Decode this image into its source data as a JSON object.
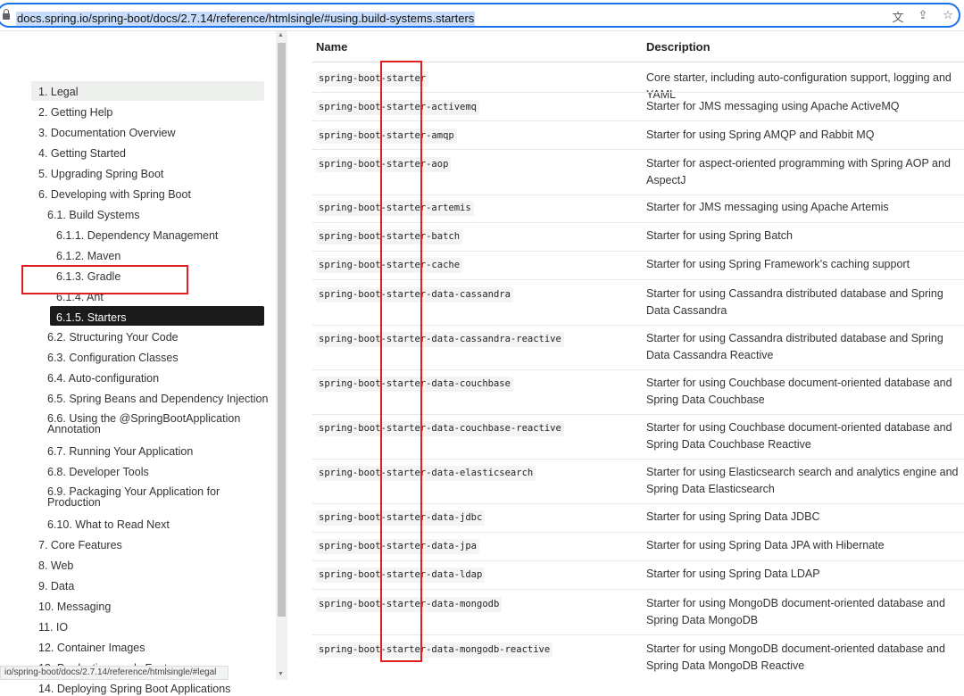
{
  "browser": {
    "url": "docs.spring.io/spring-boot/docs/2.7.14/reference/htmlsingle/#using.build-systems.starters",
    "status_url": "io/spring-boot/docs/2.7.14/reference/htmlsingle/#legal",
    "icons": [
      "lock-icon",
      "translate-icon",
      "share-icon",
      "star-icon"
    ]
  },
  "sidebar": {
    "items": [
      {
        "label": "1. Legal"
      },
      {
        "label": "2. Getting Help"
      },
      {
        "label": "3. Documentation Overview"
      },
      {
        "label": "4. Getting Started"
      },
      {
        "label": "5. Upgrading Spring Boot"
      },
      {
        "label": "6. Developing with Spring Boot"
      },
      {
        "label": "6.1. Build Systems"
      },
      {
        "label": "6.1.1. Dependency Management"
      },
      {
        "label": "6.1.2. Maven"
      },
      {
        "label": "6.1.3. Gradle"
      },
      {
        "label": "6.1.4. Ant"
      },
      {
        "label": "6.1.5. Starters"
      },
      {
        "label": "6.2. Structuring Your Code"
      },
      {
        "label": "6.3. Configuration Classes"
      },
      {
        "label": "6.4. Auto-configuration"
      },
      {
        "label": "6.5. Spring Beans and Dependency Injection"
      },
      {
        "label": "6.6. Using the @SpringBootApplication Annotation"
      },
      {
        "label": "6.7. Running Your Application"
      },
      {
        "label": "6.8. Developer Tools"
      },
      {
        "label": "6.9. Packaging Your Application for Production"
      },
      {
        "label": "6.10. What to Read Next"
      },
      {
        "label": "7. Core Features"
      },
      {
        "label": "8. Web"
      },
      {
        "label": "9. Data"
      },
      {
        "label": "10. Messaging"
      },
      {
        "label": "11. IO"
      },
      {
        "label": "12. Container Images"
      },
      {
        "label": "13. Production-ready Features"
      },
      {
        "label": "14. Deploying Spring Boot Applications"
      }
    ]
  },
  "table": {
    "headers": {
      "name": "Name",
      "description": "Description"
    },
    "rows": [
      {
        "name": "spring-boot-starter",
        "description": "Core starter, including auto-configuration support, logging and YAML"
      },
      {
        "name": "spring-boot-starter-activemq",
        "description": "Starter for JMS messaging using Apache ActiveMQ"
      },
      {
        "name": "spring-boot-starter-amqp",
        "description": "Starter for using Spring AMQP and Rabbit MQ"
      },
      {
        "name": "spring-boot-starter-aop",
        "description": "Starter for aspect-oriented programming with Spring AOP and AspectJ"
      },
      {
        "name": "spring-boot-starter-artemis",
        "description": "Starter for JMS messaging using Apache Artemis"
      },
      {
        "name": "spring-boot-starter-batch",
        "description": "Starter for using Spring Batch"
      },
      {
        "name": "spring-boot-starter-cache",
        "description": "Starter for using Spring Framework’s caching support"
      },
      {
        "name": "spring-boot-starter-data-cassandra",
        "description": "Starter for using Cassandra distributed database and Spring Data Cassandra"
      },
      {
        "name": "spring-boot-starter-data-cassandra-reactive",
        "description": "Starter for using Cassandra distributed database and Spring Data Cassandra Reactive"
      },
      {
        "name": "spring-boot-starter-data-couchbase",
        "description": "Starter for using Couchbase document-oriented database and Spring Data Couchbase"
      },
      {
        "name": "spring-boot-starter-data-couchbase-reactive",
        "description": "Starter for using Couchbase document-oriented database and Spring Data Couchbase Reactive"
      },
      {
        "name": "spring-boot-starter-data-elasticsearch",
        "description": "Starter for using Elasticsearch search and analytics engine and Spring Data Elasticsearch"
      },
      {
        "name": "spring-boot-starter-data-jdbc",
        "description": "Starter for using Spring Data JDBC"
      },
      {
        "name": "spring-boot-starter-data-jpa",
        "description": "Starter for using Spring Data JPA with Hibernate"
      },
      {
        "name": "spring-boot-starter-data-ldap",
        "description": "Starter for using Spring Data LDAP"
      },
      {
        "name": "spring-boot-starter-data-mongodb",
        "description": "Starter for using MongoDB document-oriented database and Spring Data MongoDB"
      },
      {
        "name": "spring-boot-starter-data-mongodb-reactive",
        "description": "Starter for using MongoDB document-oriented database and Spring Data MongoDB Reactive"
      }
    ]
  },
  "colors": {
    "highlight": "#e02020",
    "active_bg": "#1b1b1b",
    "legal_bg": "#edf0ec",
    "url_selection": "#c7dcfb"
  }
}
